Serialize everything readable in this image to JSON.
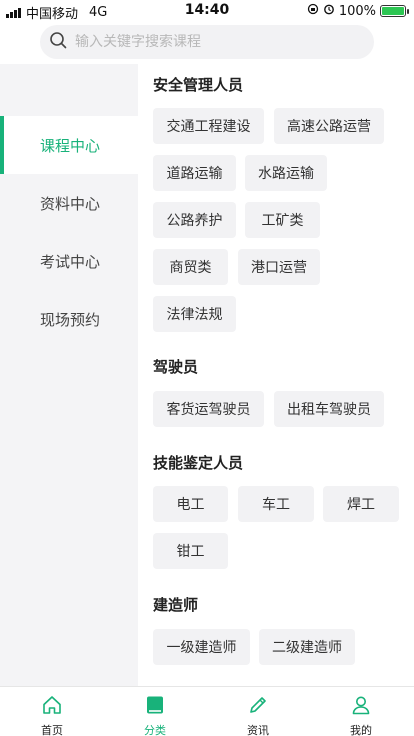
{
  "status": {
    "carrier": "中国移动",
    "network": "4G",
    "time": "14:40",
    "battery_text": "100%",
    "battery_level": 1.0
  },
  "search": {
    "placeholder": "输入关键字搜索课程"
  },
  "sidebar": {
    "items": [
      {
        "label": "课程中心",
        "active": true
      },
      {
        "label": "资料中心",
        "active": false
      },
      {
        "label": "考试中心",
        "active": false
      },
      {
        "label": "现场预约",
        "active": false
      }
    ]
  },
  "sections": [
    {
      "title": "安全管理人员",
      "tags": [
        "交通工程建设",
        "高速公路运营",
        "道路运输",
        "水路运输",
        "公路养护",
        "工矿类",
        "商贸类",
        "港口运营",
        "法律法规"
      ]
    },
    {
      "title": "驾驶员",
      "tags": [
        "客货运驾驶员",
        "出租车驾驶员"
      ]
    },
    {
      "title": "技能鉴定人员",
      "tags": [
        "电工",
        "车工",
        "焊工",
        "钳工"
      ]
    },
    {
      "title": "建造师",
      "tags": [
        "一级建造师",
        "二级建造师"
      ]
    }
  ],
  "tabbar": {
    "items": [
      {
        "label": "首页",
        "icon": "home-icon",
        "active": false
      },
      {
        "label": "分类",
        "icon": "book-icon",
        "active": true
      },
      {
        "label": "资讯",
        "icon": "pencil-icon",
        "active": false
      },
      {
        "label": "我的",
        "icon": "user-icon",
        "active": false
      }
    ]
  },
  "colors": {
    "accent": "#18b27a",
    "tag_bg": "#f2f2f4",
    "sidebar_bg": "#f4f4f6"
  }
}
